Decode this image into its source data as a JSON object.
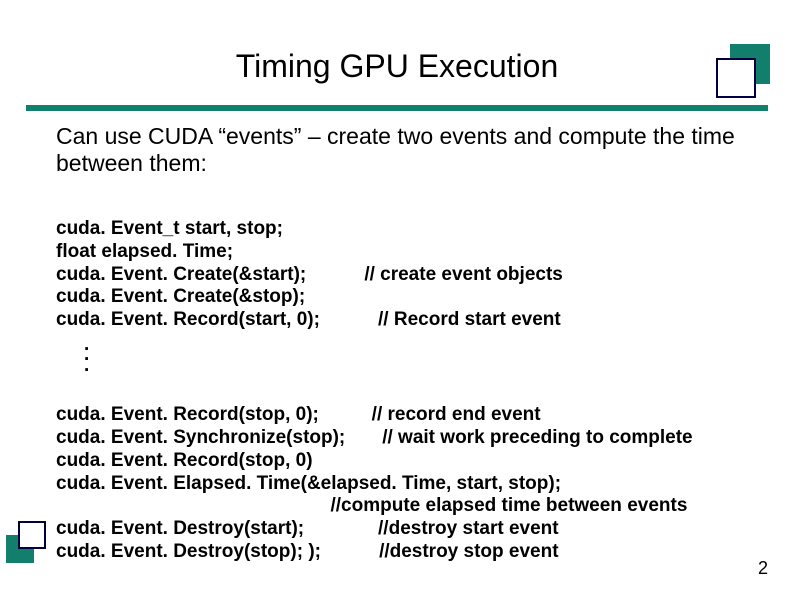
{
  "title": "Timing GPU Execution",
  "intro": "Can use CUDA “events” – create two events and compute the time between them:",
  "code1": {
    "l1": "cuda. Event_t start, stop;",
    "l2": "float elapsed. Time;",
    "l3a": "cuda. Event. Create(&start);",
    "l3b": "// create event objects",
    "l4": "cuda. Event. Create(&stop);",
    "l5a": "cuda. Event. Record(start, 0);",
    "l5b": " // Record start event"
  },
  "code2": {
    "l1a": "cuda. Event. Record(stop, 0);",
    "l1b": "// record end event",
    "l2a": "cuda. Event. Synchronize(stop);",
    "l2b": "// wait work preceding to complete",
    "l3": "cuda. Event. Record(stop, 0)",
    "l4": "cuda. Event. Elapsed. Time(&elapsed. Time, start, stop);",
    "l5b": "//compute elapsed time between events",
    "l6a": "cuda. Event. Destroy(start);",
    "l6b": "//destroy start event",
    "l7a": "cuda. Event. Destroy(stop); );",
    "l7b": "//destroy stop event"
  },
  "page_num": "2"
}
